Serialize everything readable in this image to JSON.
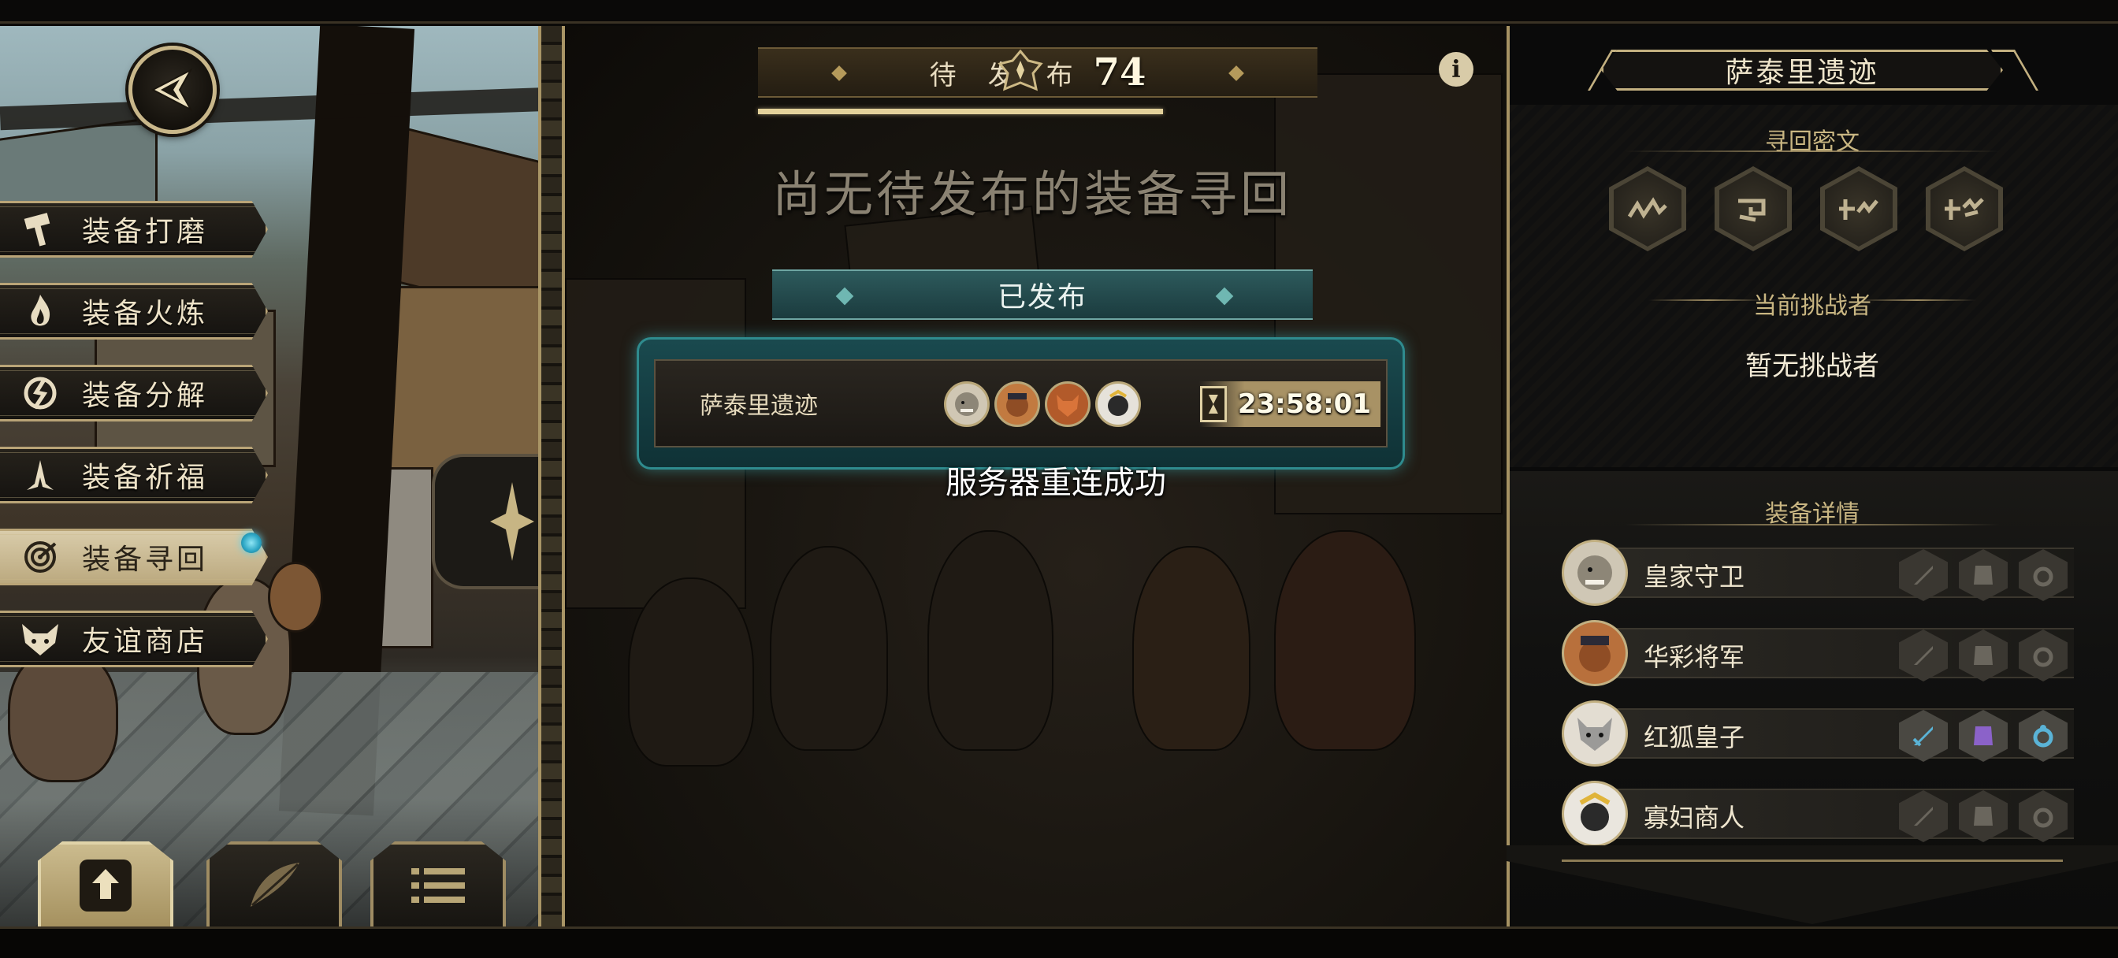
{
  "side_menu": {
    "items": [
      {
        "label": "装备打磨",
        "icon": "hammer-icon"
      },
      {
        "label": "装备火炼",
        "icon": "flame-icon"
      },
      {
        "label": "装备分解",
        "icon": "break-icon"
      },
      {
        "label": "装备祈福",
        "icon": "pray-icon"
      },
      {
        "label": "装备寻回",
        "icon": "target-icon",
        "active": true,
        "notification": true
      },
      {
        "label": "友谊商店",
        "icon": "fox-icon"
      }
    ]
  },
  "bottom_buttons": [
    {
      "name": "publish-button",
      "icon": "upload-icon"
    },
    {
      "name": "feather-button",
      "icon": "feather-icon"
    },
    {
      "name": "list-button",
      "icon": "list-icon"
    }
  ],
  "pending": {
    "label": "待发布",
    "count": "74"
  },
  "main": {
    "empty_title": "尚无待发布的装备寻回",
    "published_label": "已发布",
    "toast": "服务器重连成功"
  },
  "quest": {
    "name": "萨泰里遗迹",
    "timer": "23:58:01",
    "avatars": [
      "avatar-guard",
      "avatar-general",
      "avatar-prince",
      "avatar-widow"
    ]
  },
  "right_panel": {
    "title": "萨泰里遗迹",
    "runes_heading": "寻回密文",
    "challenger_heading": "当前挑战者",
    "challenger_value": "暂无挑战者",
    "equip_heading": "装备详情",
    "equip": [
      {
        "name": "皇家守卫",
        "slots_filled": [
          false,
          false,
          false
        ]
      },
      {
        "name": "华彩将军",
        "slots_filled": [
          false,
          false,
          false
        ]
      },
      {
        "name": "红狐皇子",
        "slots_filled": [
          true,
          true,
          true
        ]
      },
      {
        "name": "寡妇商人",
        "slots_filled": [
          false,
          false,
          false
        ]
      }
    ]
  },
  "colors": {
    "gold": "#c9b78a",
    "teal": "#2f8b8e",
    "slot_blue": "#5ab3d6",
    "slot_purple": "#8b62c9"
  }
}
